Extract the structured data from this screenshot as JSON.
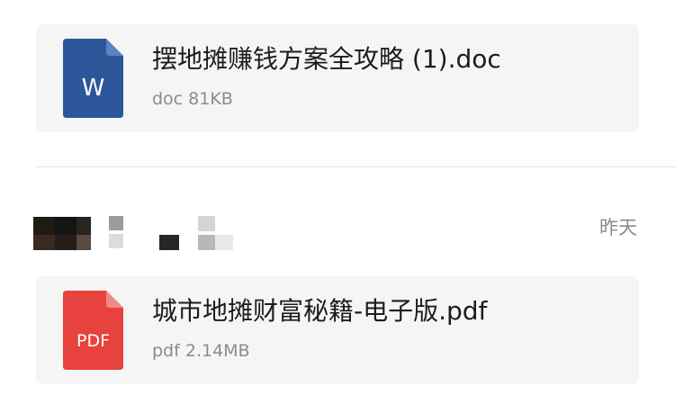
{
  "messages": [
    {
      "file": {
        "name": "摆地摊赚钱方案全攻略 (1).doc",
        "meta": "doc 81KB",
        "icon": "word-document-icon",
        "icon_label": "W",
        "icon_color": "#2b579a",
        "icon_fold_color": "#5b84c4"
      }
    },
    {
      "sender": {
        "name_censored": true
      },
      "time": "昨天",
      "file": {
        "name": "城市地摊财富秘籍-电子版.pdf",
        "meta": "pdf 2.14MB",
        "icon": "pdf-document-icon",
        "icon_label": "PDF",
        "icon_color": "#e8423f",
        "icon_fold_color": "#f08a88"
      }
    }
  ]
}
